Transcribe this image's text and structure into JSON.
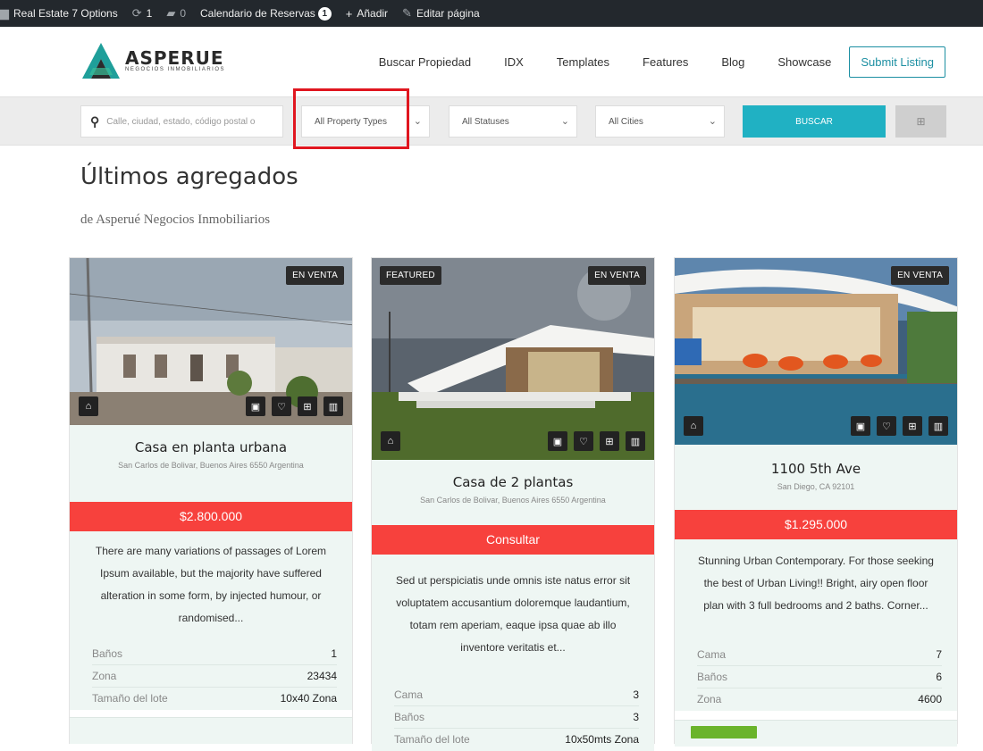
{
  "adminbar": {
    "site": "Real Estate 7 Options",
    "updates": "1",
    "comments": "0",
    "calendar": "Calendario de Reservas",
    "calendar_count": "1",
    "add": "Añadir",
    "edit": "Editar página"
  },
  "header": {
    "logo_name": "ASPERUE",
    "logo_sub": "Negocios Inmobiliarios",
    "nav": [
      "Buscar Propiedad",
      "IDX",
      "Templates",
      "Features",
      "Blog",
      "Showcase"
    ],
    "submit": "Submit Listing"
  },
  "search": {
    "placeholder": "Calle, ciudad, estado, código postal o",
    "property_types": "All Property Types",
    "statuses": "All Statuses",
    "cities": "All Cities",
    "button": "BUSCAR"
  },
  "section": {
    "title": "Últimos agregados",
    "subtitle": "de Asperué Negocios Inmobiliarios"
  },
  "listings": [
    {
      "status": "EN VENTA",
      "title": "Casa en planta urbana",
      "address": "San Carlos de Bolivar, Buenos Aires 6550 Argentina",
      "price": "$2.800.000",
      "description": "There are many variations of passages of Lorem Ipsum available, but the majority have suffered alteration in some form, by injected humour, or randomised...",
      "meta": [
        {
          "k": "Baños",
          "v": "1"
        },
        {
          "k": "Zona",
          "v": "23434"
        },
        {
          "k": "Tamaño del lote",
          "v": "10x40 Zona"
        }
      ]
    },
    {
      "featured": "FEATURED",
      "status": "EN VENTA",
      "title": "Casa de 2 plantas",
      "address": "San Carlos de Bolivar, Buenos Aires 6550 Argentina",
      "price": "Consultar",
      "description": "Sed ut perspiciatis unde omnis iste natus error sit voluptatem accusantium doloremque laudantium, totam rem aperiam, eaque ipsa quae ab illo inventore veritatis et...",
      "meta": [
        {
          "k": "Cama",
          "v": "3"
        },
        {
          "k": "Baños",
          "v": "3"
        },
        {
          "k": "Tamaño del lote",
          "v": "10x50mts Zona"
        }
      ]
    },
    {
      "status": "EN VENTA",
      "title": "1100 5th Ave",
      "address": "San Diego, CA 92101",
      "price": "$1.295.000",
      "description": "Stunning Urban Contemporary. For those seeking the best of Urban Living!! Bright, airy open floor plan with 3 full bedrooms and 2 baths. Corner...",
      "meta": [
        {
          "k": "Cama",
          "v": "7"
        },
        {
          "k": "Baños",
          "v": "6"
        },
        {
          "k": "Zona",
          "v": "4600"
        }
      ]
    }
  ]
}
